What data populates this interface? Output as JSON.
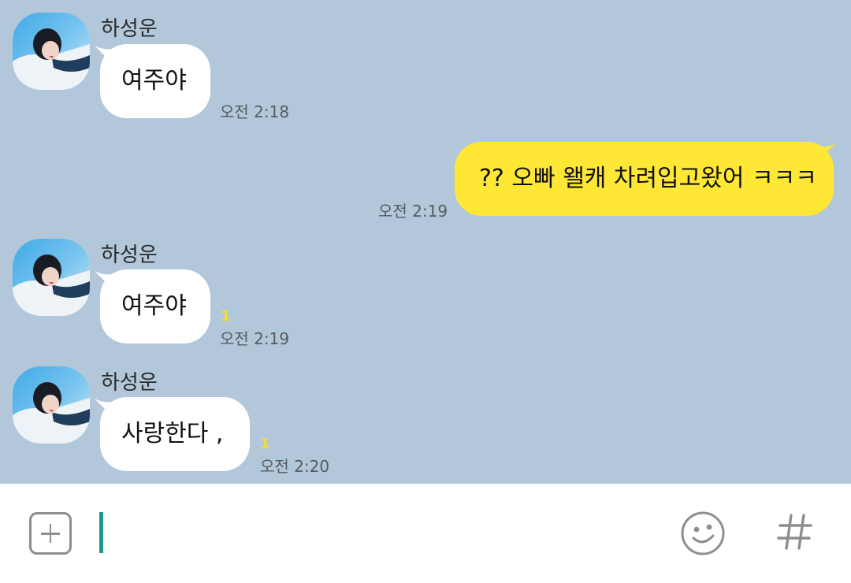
{
  "chat": {
    "messages": [
      {
        "direction": "incoming",
        "sender": "하성운",
        "text": "여주야",
        "time": "오전 2:18",
        "unread": ""
      },
      {
        "direction": "outgoing",
        "text": "?? 오빠 왤캐 차려입고왔어 ㅋㅋㅋ",
        "time": "오전 2:19"
      },
      {
        "direction": "incoming",
        "sender": "하성운",
        "text": "여주야",
        "time": "오전 2:19",
        "unread": "1"
      },
      {
        "direction": "incoming",
        "sender": "하성운",
        "text": "사랑한다 ,",
        "time": "오전 2:20",
        "unread": "1"
      }
    ]
  },
  "input_bar": {
    "plus_icon": "plus-square-icon",
    "emoji_icon": "smiley-face-icon",
    "hash_icon": "hash-icon",
    "message_value": ""
  },
  "colors": {
    "chat_background": "#b2c7d9",
    "incoming_bubble": "#ffffff",
    "outgoing_bubble": "#fee835",
    "unread_count": "#f2dc36",
    "cursor": "#1d9b8a",
    "icon_gray": "#8e8e8e"
  }
}
